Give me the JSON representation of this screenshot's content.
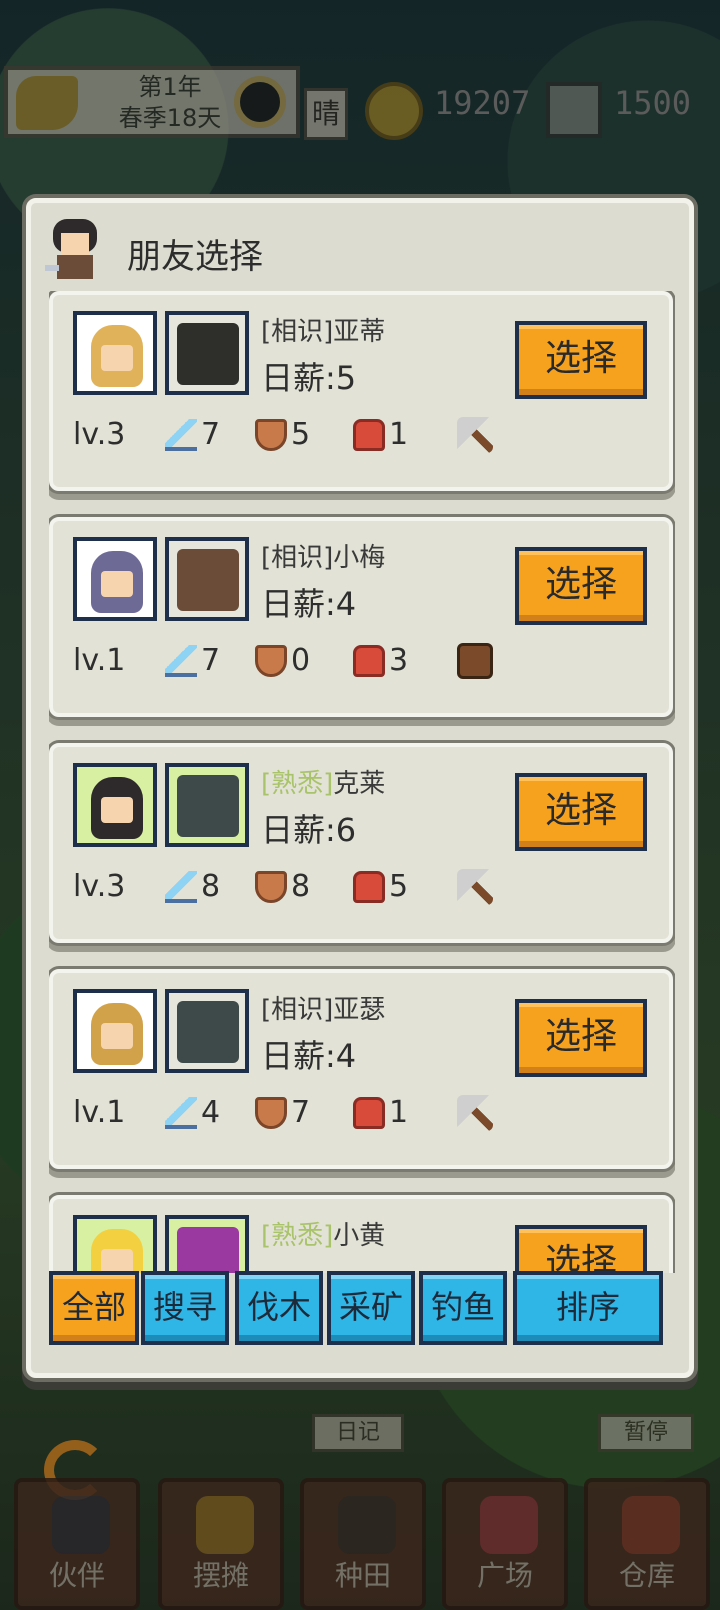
{
  "hud": {
    "date_line1": "第1年",
    "date_line2": "春季18天",
    "weather": "晴",
    "gold": "19207",
    "gems": "1500"
  },
  "dialog": {
    "title": "朋友选择",
    "select_label": "选择",
    "wage_prefix": "日薪:",
    "friends": [
      {
        "relation": "[相识]",
        "name": "亚蒂",
        "wage": "5",
        "level": "lv.3",
        "attack": "7",
        "defense": "5",
        "potion": "1",
        "gear": "axe-icon",
        "familiar": false
      },
      {
        "relation": "[相识]",
        "name": "小梅",
        "wage": "4",
        "level": "lv.1",
        "attack": "7",
        "defense": "0",
        "potion": "3",
        "gear": "bag-icon",
        "familiar": false
      },
      {
        "relation": "[熟悉]",
        "name": "克莱",
        "wage": "6",
        "level": "lv.3",
        "attack": "8",
        "defense": "8",
        "potion": "5",
        "gear": "axe-icon",
        "familiar": true
      },
      {
        "relation": "[相识]",
        "name": "亚瑟",
        "wage": "4",
        "level": "lv.1",
        "attack": "4",
        "defense": "7",
        "potion": "1",
        "gear": "axe-icon",
        "familiar": false
      },
      {
        "relation": "[熟悉]",
        "name": "小黄",
        "familiar": true
      }
    ],
    "filters": [
      "全部",
      "搜寻",
      "伐木",
      "采矿",
      "钓鱼"
    ],
    "sort_label": "排序"
  },
  "background_buttons": {
    "diary": "日记",
    "pause": "暂停"
  },
  "bottom_nav": [
    "伙伴",
    "摆摊",
    "种田",
    "广场",
    "仓库"
  ],
  "colors": {
    "accent_orange": "#f7a21e",
    "accent_blue": "#2fb5e6",
    "familiar_green": "#a9c36a"
  }
}
